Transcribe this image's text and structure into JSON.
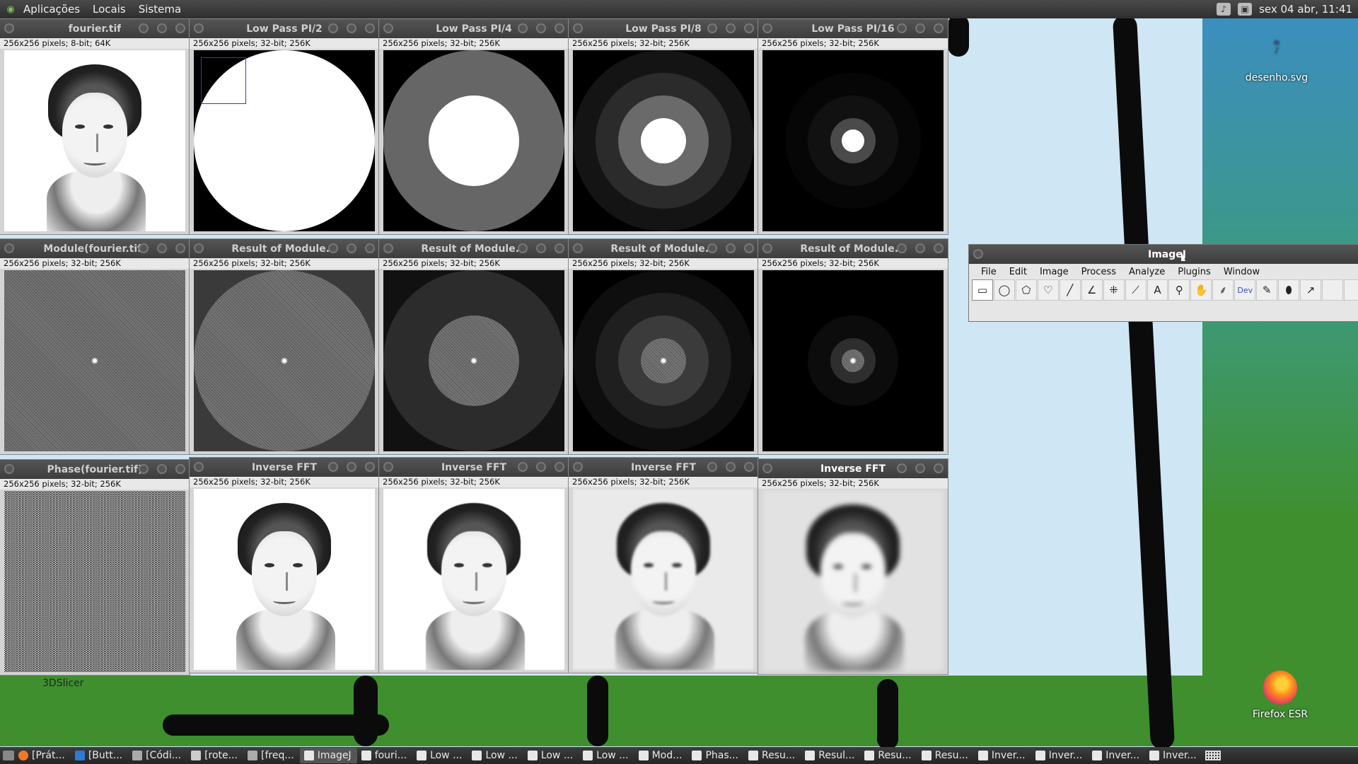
{
  "top_panel": {
    "menus": [
      "Aplicações",
      "Locais",
      "Sistema"
    ],
    "clock": "sex 04 abr, 11:41"
  },
  "desktop_icons": {
    "svg_file": "desenho.svg",
    "firefox": "Firefox ESR",
    "slicer": "3DSlicer"
  },
  "windows": [
    {
      "title": "fourier.tif",
      "info": "256x256 pixels; 8-bit; 64K"
    },
    {
      "title": "Low Pass PI/2",
      "info": "256x256 pixels; 32-bit; 256K"
    },
    {
      "title": "Low Pass PI/4",
      "info": "256x256 pixels; 32-bit; 256K"
    },
    {
      "title": "Low Pass PI/8",
      "info": "256x256 pixels; 32-bit; 256K"
    },
    {
      "title": "Low Pass PI/16",
      "info": "256x256 pixels; 32-bit; 256K"
    },
    {
      "title": "Module(fourier.tif)",
      "info": "256x256 pixels; 32-bit; 256K"
    },
    {
      "title": "Result of Module...",
      "info": "256x256 pixels; 32-bit; 256K"
    },
    {
      "title": "Result of Module...",
      "info": "256x256 pixels; 32-bit; 256K"
    },
    {
      "title": "Result of Module...",
      "info": "256x256 pixels; 32-bit; 256K"
    },
    {
      "title": "Result of Module...",
      "info": "256x256 pixels; 32-bit; 256K"
    },
    {
      "title": "Phase(fourier.tif)",
      "info": "256x256 pixels; 32-bit; 256K"
    },
    {
      "title": "Inverse FFT",
      "info": "256x256 pixels; 32-bit; 256K"
    },
    {
      "title": "Inverse FFT",
      "info": "256x256 pixels; 32-bit; 256K"
    },
    {
      "title": "Inverse FFT",
      "info": "256x256 pixels; 32-bit; 256K"
    },
    {
      "title": "Inverse FFT",
      "info": "256x256 pixels; 32-bit; 256K"
    }
  ],
  "imagej": {
    "title": "ImageJ",
    "menu": [
      "File",
      "Edit",
      "Image",
      "Process",
      "Analyze",
      "Plugins",
      "Window"
    ],
    "dev_label": "Dev"
  },
  "taskbar": [
    {
      "label": "[Prát...",
      "icon": "firefox-icon"
    },
    {
      "label": "[Butt...",
      "icon": "vscode-icon"
    },
    {
      "label": "[Códi...",
      "icon": "folder-icon"
    },
    {
      "label": "[rote...",
      "icon": "document-icon"
    },
    {
      "label": "[freq...",
      "icon": "folder-icon"
    },
    {
      "label": "ImageJ",
      "icon": "imagej-icon",
      "active": true
    },
    {
      "label": "fouri...",
      "icon": "imagej-icon"
    },
    {
      "label": "Low ...",
      "icon": "imagej-icon"
    },
    {
      "label": "Low ...",
      "icon": "imagej-icon"
    },
    {
      "label": "Low ...",
      "icon": "imagej-icon"
    },
    {
      "label": "Low ...",
      "icon": "imagej-icon"
    },
    {
      "label": "Mod...",
      "icon": "imagej-icon"
    },
    {
      "label": "Phas...",
      "icon": "imagej-icon"
    },
    {
      "label": "Resu...",
      "icon": "imagej-icon"
    },
    {
      "label": "Resul...",
      "icon": "imagej-icon"
    },
    {
      "label": "Resu...",
      "icon": "imagej-icon"
    },
    {
      "label": "Resu...",
      "icon": "imagej-icon"
    },
    {
      "label": "Inver...",
      "icon": "imagej-icon"
    },
    {
      "label": "Inver...",
      "icon": "imagej-icon"
    },
    {
      "label": "Inver...",
      "icon": "imagej-icon"
    },
    {
      "label": "Inver...",
      "icon": "imagej-icon"
    }
  ]
}
